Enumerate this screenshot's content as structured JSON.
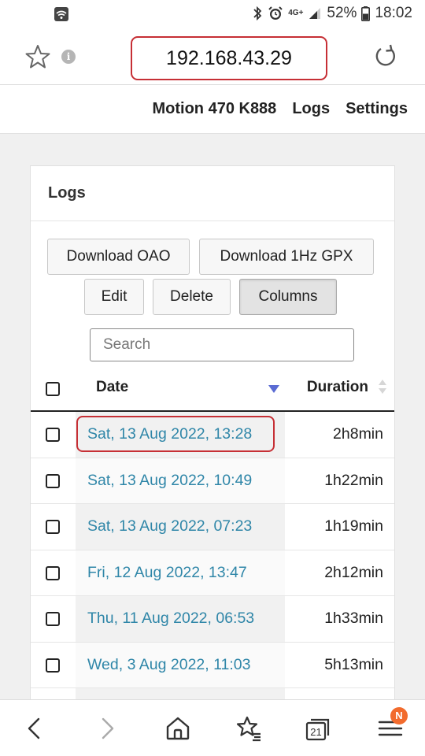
{
  "status_bar": {
    "battery_percent": "52%",
    "time": "18:02",
    "network": "4G+"
  },
  "browser": {
    "url": "192.168.43.29",
    "info_glyph": "i"
  },
  "site_nav": {
    "items": [
      "Motion 470 K888",
      "Logs",
      "Settings"
    ]
  },
  "panel": {
    "title": "Logs",
    "buttons": {
      "download_oao": "Download OAO",
      "download_gpx": "Download 1Hz GPX",
      "edit": "Edit",
      "delete": "Delete",
      "columns": "Columns"
    },
    "search_placeholder": "Search",
    "table": {
      "columns": [
        "Date",
        "Duration"
      ],
      "sort_column": "Date",
      "sort_direction": "descending",
      "rows": [
        {
          "date": "Sat, 13 Aug 2022, 13:28",
          "duration": "2h8min",
          "highlighted": true
        },
        {
          "date": "Sat, 13 Aug 2022, 10:49",
          "duration": "1h22min"
        },
        {
          "date": "Sat, 13 Aug 2022, 07:23",
          "duration": "1h19min"
        },
        {
          "date": "Fri, 12 Aug 2022, 13:47",
          "duration": "2h12min"
        },
        {
          "date": "Thu, 11 Aug 2022, 06:53",
          "duration": "1h33min"
        },
        {
          "date": "Wed, 3 Aug 2022, 11:03",
          "duration": "5h13min"
        }
      ]
    }
  },
  "bottom_nav": {
    "tabs_count": "21",
    "menu_badge": "N"
  },
  "colors": {
    "link": "#2f86a8",
    "highlight_outline": "#c62f35",
    "badge": "#f26b2d",
    "sort_arrow": "#5a6bd3"
  }
}
